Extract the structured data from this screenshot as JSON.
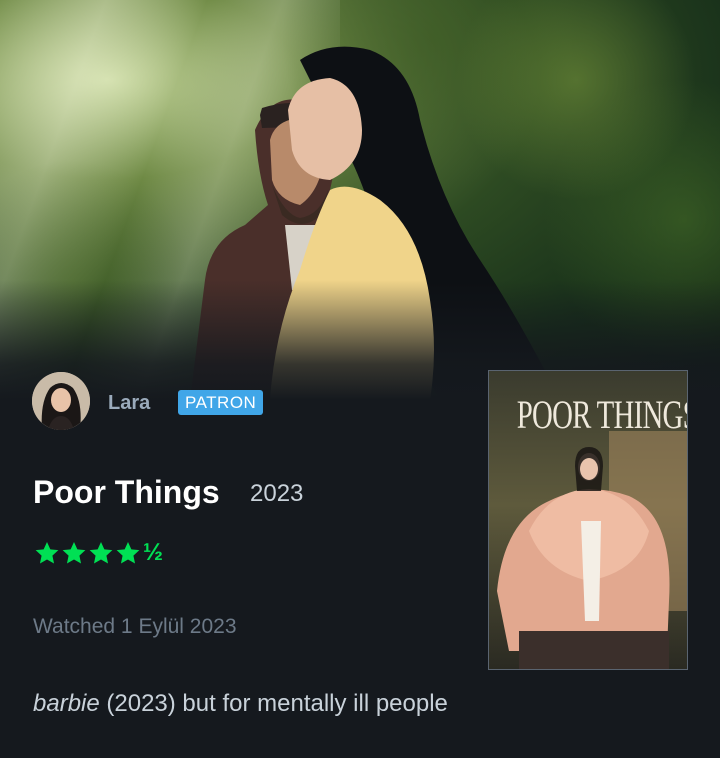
{
  "review": {
    "user": {
      "name": "Lara",
      "badge": "PATRON"
    },
    "film": {
      "title": "Poor Things",
      "year": "2023"
    },
    "rating": {
      "stars": 4.5,
      "half_glyph": "½",
      "color": "#00e054"
    },
    "watched": "Watched 1 Eylül 2023",
    "text": {
      "emphasis": "barbie",
      "rest": " (2023) but for mentally ill people"
    },
    "poster": {
      "title": "POOR THINGS"
    }
  },
  "colors": {
    "background": "#15191e",
    "badge": "#40a6e8",
    "accent_green": "#00e054",
    "muted_text": "#6d7a88"
  }
}
